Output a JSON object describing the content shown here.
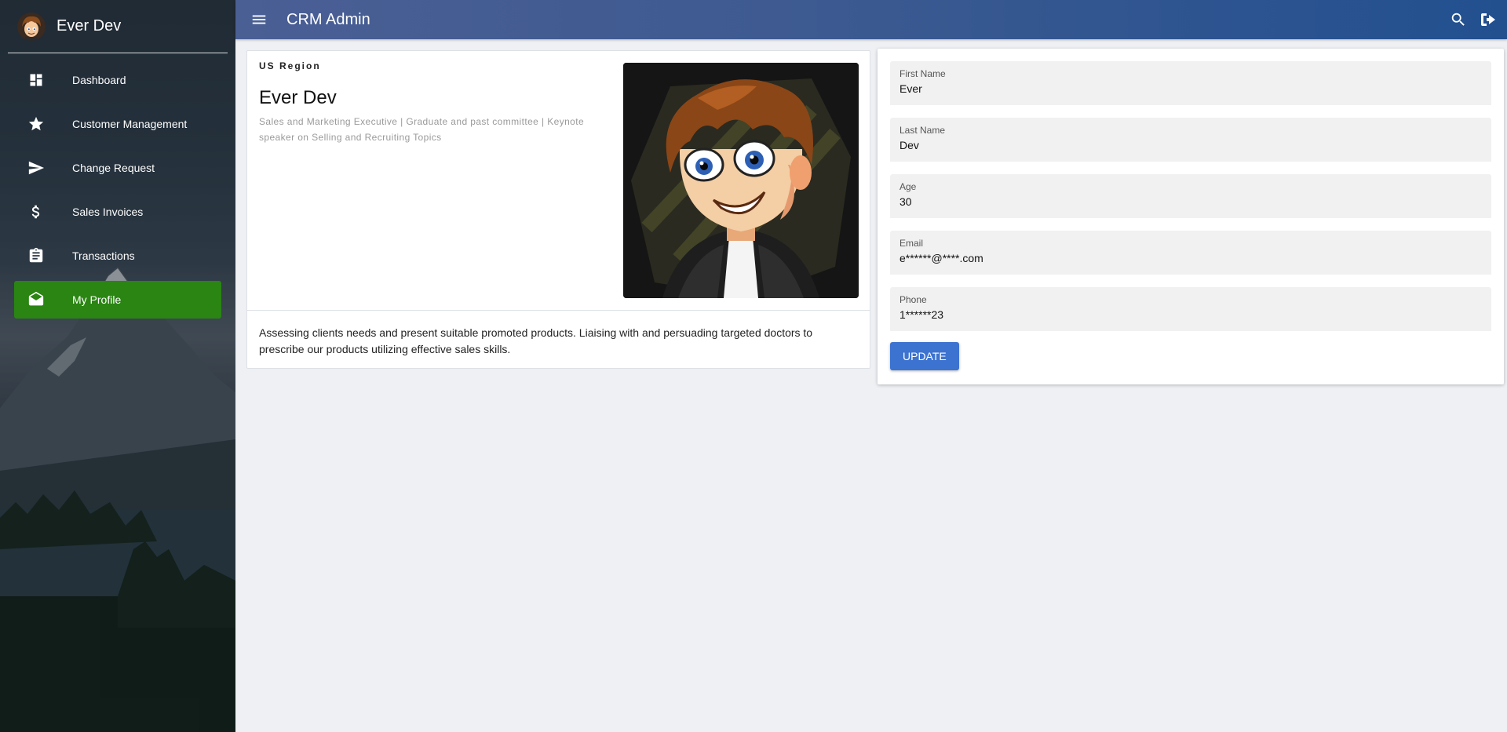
{
  "sidebar": {
    "brand_name": "Ever Dev",
    "items": [
      {
        "label": "Dashboard",
        "icon": "dashboard-icon"
      },
      {
        "label": "Customer Management",
        "icon": "star-icon"
      },
      {
        "label": "Change Request",
        "icon": "send-icon"
      },
      {
        "label": "Sales Invoices",
        "icon": "dollar-icon"
      },
      {
        "label": "Transactions",
        "icon": "clipboard-icon"
      },
      {
        "label": "My Profile",
        "icon": "mail-open-icon",
        "active": true
      }
    ]
  },
  "header": {
    "title": "CRM Admin",
    "icons": [
      "menu-icon",
      "search-icon",
      "logout-icon"
    ]
  },
  "profile": {
    "region": "US Region",
    "name": "Ever Dev",
    "tagline": "Sales and Marketing Executive | Graduate and past committee | Keynote speaker on Selling and Recruiting Topics",
    "summary": "Assessing clients needs and present suitable promoted products. Liaising with and persuading targeted doctors to prescribe our products utilizing effective sales skills."
  },
  "form": {
    "fields": [
      {
        "label": "First Name",
        "value": "Ever"
      },
      {
        "label": "Last Name",
        "value": "Dev"
      },
      {
        "label": "Age",
        "value": "30"
      },
      {
        "label": "Email",
        "value": "e******@****.com"
      },
      {
        "label": "Phone",
        "value": "1******23"
      }
    ],
    "submit_label": "UPDATE"
  },
  "colors": {
    "active_nav": "#2a8512",
    "topbar": "#2b5592",
    "button": "#3d73d0"
  }
}
